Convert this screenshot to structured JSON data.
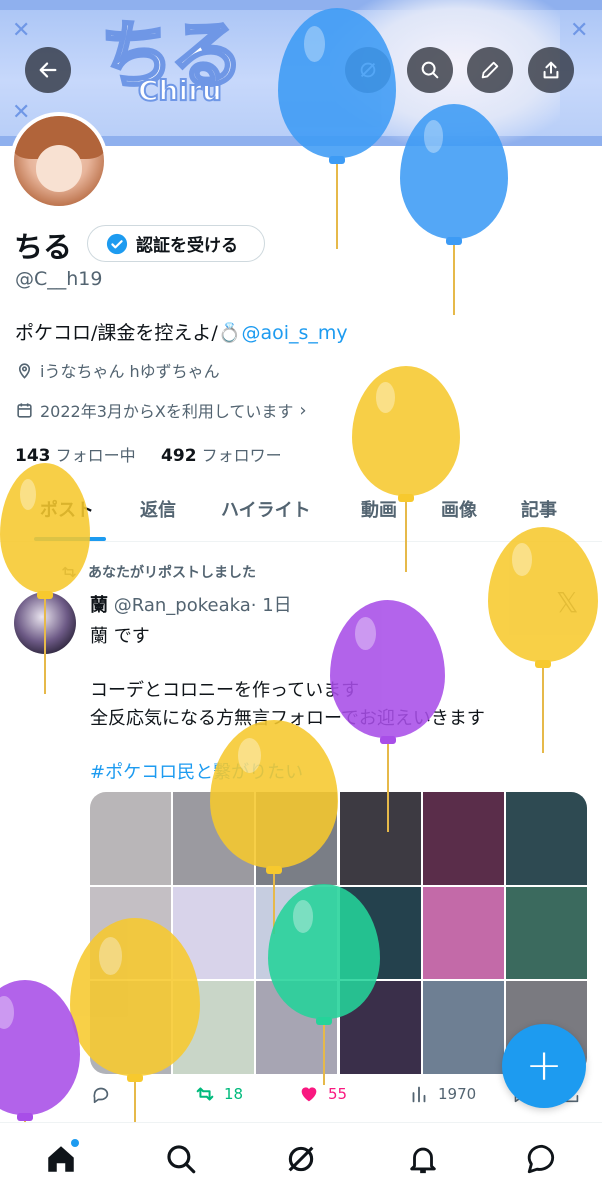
{
  "banner": {
    "logo_text": "ちる",
    "logo_sub": "Chiru"
  },
  "profile": {
    "name": "ちる",
    "verify_label": "認証を受ける",
    "handle": "@C__h19",
    "bio_text": "ポケコロ/課金を控えよ/💍",
    "bio_link": "@aoi_s_my",
    "location": "iうなちゃん hゆずちゃん",
    "joined": "2022年3月からXを利用しています",
    "following_count": "143",
    "following_label": "フォロー中",
    "followers_count": "492",
    "followers_label": "フォロワー"
  },
  "tabs": [
    "ポスト",
    "返信",
    "ハイライト",
    "動画",
    "画像",
    "記事"
  ],
  "post": {
    "repost_note": "あなたがリポストしました",
    "author": "蘭",
    "author_handle": "@Ran_pokeaka",
    "time": "· 1日",
    "line1": "蘭 です",
    "line2": "コーデとコロニーを作っています",
    "line3": "全反応気になる方無言フォローでお迎えいきます",
    "hashtag": "#ポケコロ民と繋がりたい",
    "retweets": "18",
    "likes": "55",
    "views": "1970"
  },
  "colors": {
    "accent": "#1d9bf0",
    "retweet": "#00ba7c",
    "like": "#f91880",
    "balloon_blue": "#3d9bf5",
    "balloon_yellow": "#f7c92e",
    "balloon_purple": "#a84ee8",
    "balloon_green": "#25d39a"
  },
  "icons": {
    "top_bar": [
      "back-arrow-icon",
      "grok-icon",
      "search-icon",
      "edit-icon",
      "share-icon"
    ],
    "bottom_nav": [
      "home-icon",
      "search-icon",
      "grok-icon",
      "bell-icon",
      "messages-icon"
    ]
  }
}
